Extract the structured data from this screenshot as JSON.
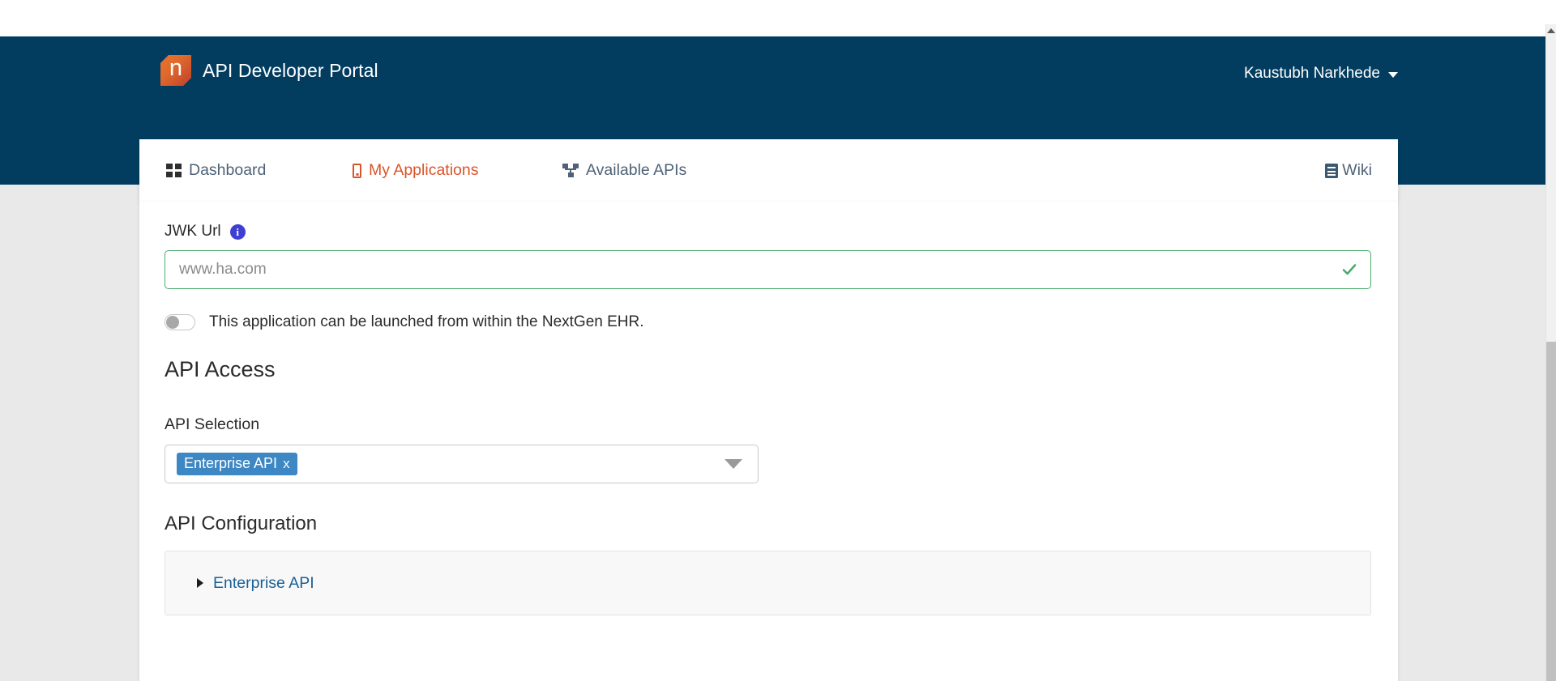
{
  "header": {
    "brand_logo_letter": "n",
    "brand_logo_name": "nextgen-logo",
    "title": "API Developer Portal",
    "background_color": "#023d60"
  },
  "user_menu": {
    "name": "Kaustubh Narkhede",
    "caret_icon": "chevron-down-icon"
  },
  "nav": {
    "items": [
      {
        "label": "Dashboard",
        "icon": "grid-icon",
        "active": false,
        "color": "#4f6277"
      },
      {
        "label": "My Applications",
        "icon": "mobile-icon",
        "active": true,
        "color": "#d9542b"
      },
      {
        "label": "Available APIs",
        "icon": "sitemap-icon",
        "active": false,
        "color": "#4f6277"
      },
      {
        "label": "Wiki",
        "icon": "book-icon",
        "active": false,
        "color": "#4f6277"
      }
    ]
  },
  "form": {
    "jwk_url": {
      "label": "JWK Url",
      "info_icon": "info-icon",
      "info_icon_color": "#3f3fd1",
      "value": "",
      "placeholder": "www.ha.com",
      "valid": true,
      "border_color": "#4aab6d",
      "check_icon": "check-icon",
      "check_color": "#4aab6d"
    },
    "ehr_toggle": {
      "label": "This application can be launched from within the NextGen EHR.",
      "state": "off"
    }
  },
  "api_access": {
    "heading": "API Access",
    "selection": {
      "label": "API Selection",
      "selected": [
        {
          "label": "Enterprise API",
          "remove_label": "x"
        }
      ],
      "chip_color": "#3c87c4",
      "caret_icon": "caret-down-icon"
    },
    "configuration": {
      "heading": "API Configuration",
      "items": [
        {
          "label": "Enterprise API",
          "expanded": false,
          "toggle_icon": "triangle-right-icon"
        }
      ]
    }
  },
  "scrollbar": {
    "up_arrow_icon": "scroll-up-arrow-icon",
    "thumb_name": "scrollbar-thumb"
  }
}
